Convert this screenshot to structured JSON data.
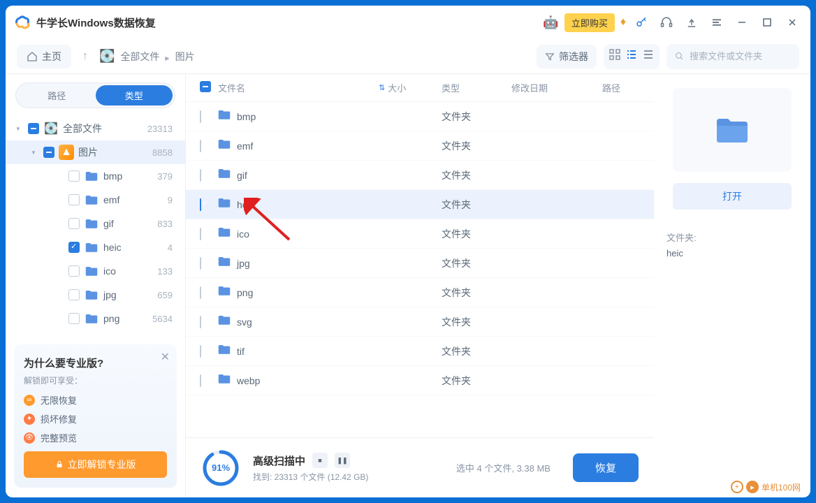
{
  "app": {
    "title": "牛学长Windows数据恢复"
  },
  "titlebar": {
    "buy_label": "立即购买"
  },
  "toolbar": {
    "home_label": "主页",
    "breadcrumb": [
      "全部文件",
      "图片"
    ],
    "filter_label": "筛选器",
    "search_placeholder": "搜索文件或文件夹"
  },
  "sidebar": {
    "tab_path": "路径",
    "tab_type": "类型",
    "root": {
      "label": "全部文件",
      "count": "23313"
    },
    "images": {
      "label": "图片",
      "count": "8858"
    },
    "types": [
      {
        "label": "bmp",
        "count": "379",
        "checked": false
      },
      {
        "label": "emf",
        "count": "9",
        "checked": false
      },
      {
        "label": "gif",
        "count": "833",
        "checked": false
      },
      {
        "label": "heic",
        "count": "4",
        "checked": true
      },
      {
        "label": "ico",
        "count": "133",
        "checked": false
      },
      {
        "label": "jpg",
        "count": "659",
        "checked": false
      },
      {
        "label": "png",
        "count": "5634",
        "checked": false
      }
    ]
  },
  "promo": {
    "title": "为什么要专业版?",
    "subtitle": "解锁即可享受：",
    "feat1": "无限恢复",
    "feat2": "损坏修复",
    "feat3": "完整预览",
    "button": "立即解锁专业版"
  },
  "list": {
    "headers": {
      "name": "文件名",
      "size": "大小",
      "type": "类型",
      "date": "修改日期",
      "path": "路径"
    },
    "rows": [
      {
        "name": "bmp",
        "type": "文件夹",
        "checked": false
      },
      {
        "name": "emf",
        "type": "文件夹",
        "checked": false
      },
      {
        "name": "gif",
        "type": "文件夹",
        "checked": false
      },
      {
        "name": "heic",
        "type": "文件夹",
        "checked": true
      },
      {
        "name": "ico",
        "type": "文件夹",
        "checked": false
      },
      {
        "name": "jpg",
        "type": "文件夹",
        "checked": false
      },
      {
        "name": "png",
        "type": "文件夹",
        "checked": false
      },
      {
        "name": "svg",
        "type": "文件夹",
        "checked": false
      },
      {
        "name": "tif",
        "type": "文件夹",
        "checked": false
      },
      {
        "name": "webp",
        "type": "文件夹",
        "checked": false
      }
    ]
  },
  "preview": {
    "open_label": "打开",
    "folder_label": "文件夹:",
    "folder_value": "heic"
  },
  "footer": {
    "percent": "91%",
    "scan_title": "高级扫描中",
    "scan_sub": "找到: 23313 个文件 (12.42 GB)",
    "selected": "选中 4 个文件, 3.38 MB",
    "recover_label": "恢复"
  },
  "watermark": "单机100网"
}
